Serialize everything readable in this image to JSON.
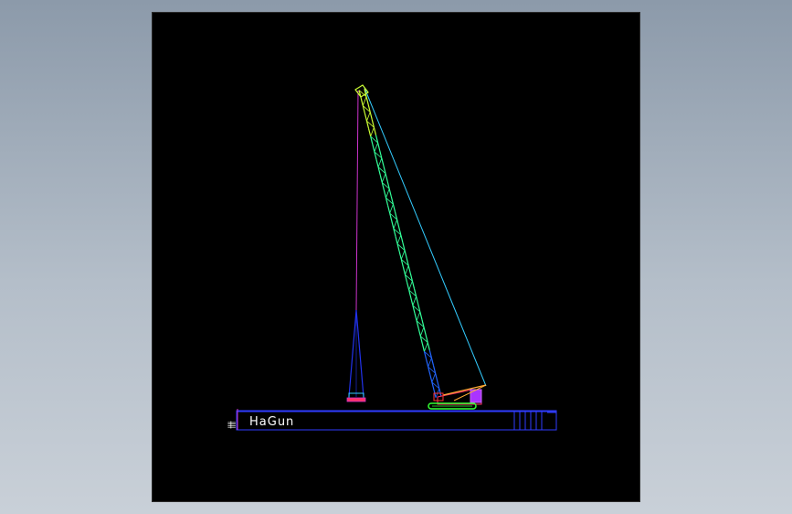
{
  "drawing": {
    "barge_name": "HaGun",
    "side_mark": "卌"
  },
  "colors": {
    "background": "#000000",
    "page": "#9aa6b4",
    "barge_outline": "#2f3cff",
    "boom_main": "#33ff99",
    "boom_tip": "#ccff33",
    "hoist_line": "#cc33cc",
    "pendant_line": "#33ccff",
    "tower_legs": "#2233ee",
    "counterweight": "#aa33ff",
    "gantry": "#ffaa33",
    "crawler": "#33ff33",
    "label": "#ffffff"
  },
  "icons": [
    "crane-boom-icon",
    "barge-icon",
    "tower-icon"
  ]
}
